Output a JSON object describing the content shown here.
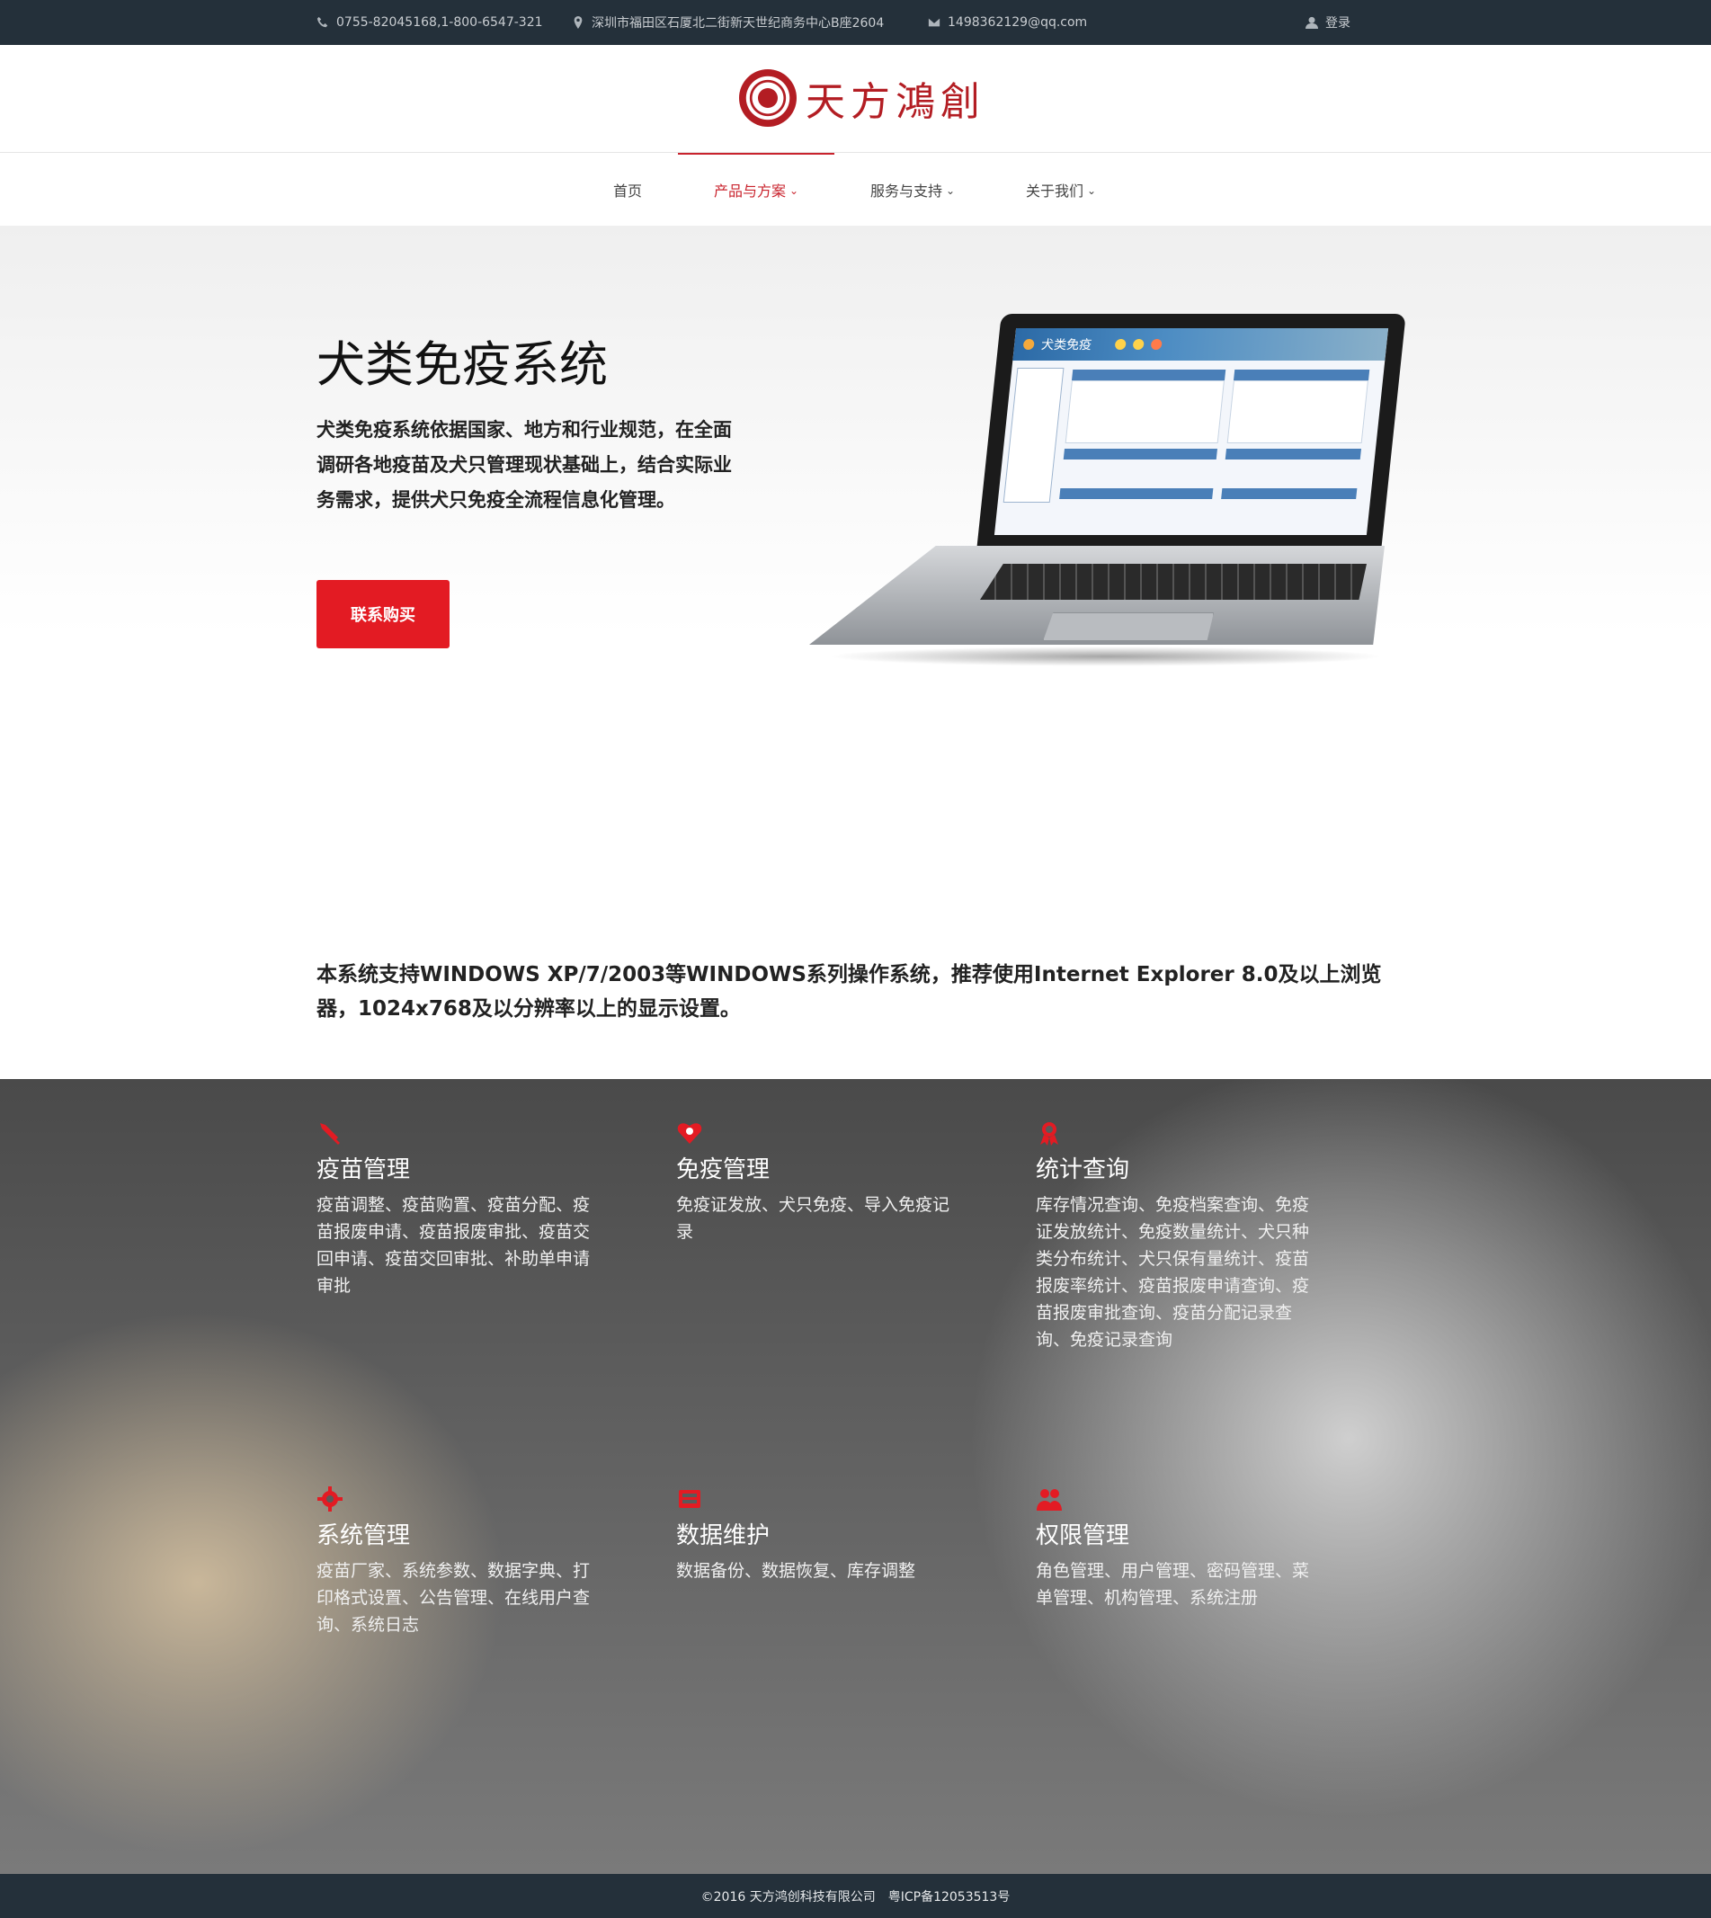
{
  "topbar": {
    "phone": "0755-82045168,1-800-6547-321",
    "address": "深圳市福田区石厦北二街新天世纪商务中心B座2604",
    "email": "1498362129@qq.com",
    "login": "登录"
  },
  "header": {
    "logo_text": "天方鴻創"
  },
  "nav": {
    "items": [
      {
        "label": "首页",
        "dropdown": false
      },
      {
        "label": "产品与方案",
        "dropdown": true,
        "active": true
      },
      {
        "label": "服务与支持",
        "dropdown": true
      },
      {
        "label": "关于我们",
        "dropdown": true
      }
    ]
  },
  "hero": {
    "title": "犬类免疫系统",
    "description": "犬类免疫系统依据国家、地方和行业规范，在全面调研各地疫苗及犬只管理现状基础上，结合实际业务需求，提供犬只免疫全流程信息化管理。",
    "cta": "联系购买",
    "screen_title": "犬类免疫"
  },
  "requirements": {
    "text": "本系统支持WINDOWS XP/7/2003等WINDOWS系列操作系统，推荐使用Internet Explorer 8.0及以上浏览器，1024x768及以分辨率以上的显示设置。"
  },
  "features": [
    {
      "icon": "syringe-icon",
      "title": "疫苗管理",
      "desc": "疫苗调整、疫苗购置、疫苗分配、疫苗报废申请、疫苗报废审批、疫苗交回申请、疫苗交回审批、补助单申请审批"
    },
    {
      "icon": "heart-shield-icon",
      "title": "免疫管理",
      "desc": "免疫证发放、犬只免疫、导入免疫记录"
    },
    {
      "icon": "award-icon",
      "title": "统计查询",
      "desc": "库存情况查询、免疫档案查询、免疫证发放统计、免疫数量统计、犬只种类分布统计、犬只保有量统计、疫苗报废率统计、疫苗报废申请查询、疫苗报废审批查询、疫苗分配记录查询、免疫记录查询"
    },
    {
      "icon": "gear-icon",
      "title": "系统管理",
      "desc": "疫苗厂家、系统参数、数据字典、打印格式设置、公告管理、在线用户查询、系统日志"
    },
    {
      "icon": "database-icon",
      "title": "数据维护",
      "desc": "数据备份、数据恢复、库存调整"
    },
    {
      "icon": "users-icon",
      "title": "权限管理",
      "desc": "角色管理、用户管理、密码管理、菜单管理、机构管理、系统注册"
    }
  ],
  "footer": {
    "copyright": "©2016 天方鸿创科技有限公司",
    "icp": "粤ICP备12053513号"
  },
  "colors": {
    "accent": "#e31b23",
    "dark_bar": "#24303a",
    "brand_red": "#b31d23"
  }
}
